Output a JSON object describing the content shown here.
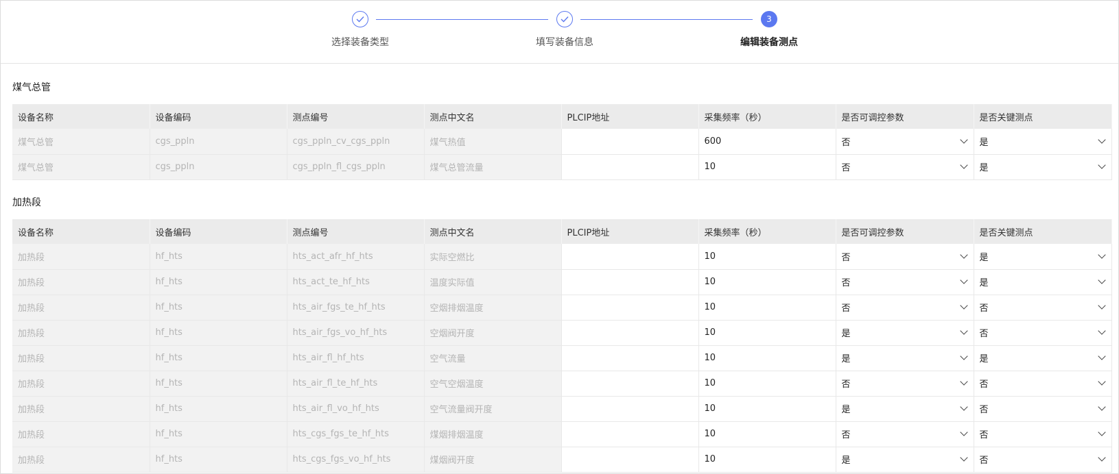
{
  "steps": [
    {
      "label": "选择装备类型",
      "state": "done"
    },
    {
      "label": "填写装备信息",
      "state": "done"
    },
    {
      "label": "编辑装备测点",
      "state": "active",
      "number": "3"
    }
  ],
  "columns": [
    "设备名称",
    "设备编码",
    "测点编号",
    "测点中文名",
    "PLCIP地址",
    "采集频率（秒）",
    "是否可调控参数",
    "是否关键测点"
  ],
  "sections": [
    {
      "title": "煤气总管",
      "rows": [
        {
          "name": "煤气总管",
          "code": "cgs_ppln",
          "point_id": "cgs_ppln_cv_cgs_ppln",
          "point_name": "煤气热值",
          "plcip": "",
          "freq": "600",
          "adjustable": "否",
          "key": "是"
        },
        {
          "name": "煤气总管",
          "code": "cgs_ppln",
          "point_id": "cgs_ppln_fl_cgs_ppln",
          "point_name": "煤气总管流量",
          "plcip": "",
          "freq": "10",
          "adjustable": "否",
          "key": "是"
        }
      ]
    },
    {
      "title": "加热段",
      "rows": [
        {
          "name": "加热段",
          "code": "hf_hts",
          "point_id": "hts_act_afr_hf_hts",
          "point_name": "实际空燃比",
          "plcip": "",
          "freq": "10",
          "adjustable": "否",
          "key": "是"
        },
        {
          "name": "加热段",
          "code": "hf_hts",
          "point_id": "hts_act_te_hf_hts",
          "point_name": "温度实际值",
          "plcip": "",
          "freq": "10",
          "adjustable": "否",
          "key": "是"
        },
        {
          "name": "加热段",
          "code": "hf_hts",
          "point_id": "hts_air_fgs_te_hf_hts",
          "point_name": "空烟排烟温度",
          "plcip": "",
          "freq": "10",
          "adjustable": "否",
          "key": "否"
        },
        {
          "name": "加热段",
          "code": "hf_hts",
          "point_id": "hts_air_fgs_vo_hf_hts",
          "point_name": "空烟阀开度",
          "plcip": "",
          "freq": "10",
          "adjustable": "是",
          "key": "否"
        },
        {
          "name": "加热段",
          "code": "hf_hts",
          "point_id": "hts_air_fl_hf_hts",
          "point_name": "空气流量",
          "plcip": "",
          "freq": "10",
          "adjustable": "是",
          "key": "是"
        },
        {
          "name": "加热段",
          "code": "hf_hts",
          "point_id": "hts_air_fl_te_hf_hts",
          "point_name": "空气空烟温度",
          "plcip": "",
          "freq": "10",
          "adjustable": "否",
          "key": "否"
        },
        {
          "name": "加热段",
          "code": "hf_hts",
          "point_id": "hts_air_fl_vo_hf_hts",
          "point_name": "空气流量阀开度",
          "plcip": "",
          "freq": "10",
          "adjustable": "是",
          "key": "否"
        },
        {
          "name": "加热段",
          "code": "hf_hts",
          "point_id": "hts_cgs_fgs_te_hf_hts",
          "point_name": "煤烟排烟温度",
          "plcip": "",
          "freq": "10",
          "adjustable": "否",
          "key": "否"
        },
        {
          "name": "加热段",
          "code": "hf_hts",
          "point_id": "hts_cgs_fgs_vo_hf_hts",
          "point_name": "煤烟阀开度",
          "plcip": "",
          "freq": "10",
          "adjustable": "是",
          "key": "否"
        }
      ]
    }
  ],
  "colors": {
    "accent": "#5b78f0"
  }
}
